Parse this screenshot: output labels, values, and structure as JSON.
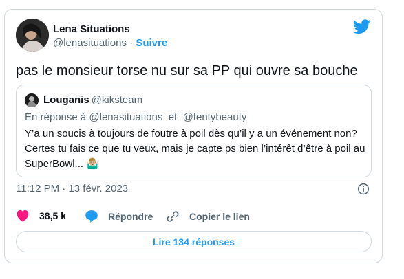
{
  "author": {
    "name": "Lena Situations",
    "handle": "@lenasituations",
    "separator": " · ",
    "follow_label": "Suivre"
  },
  "tweet": {
    "text": "pas le monsieur torse nu sur sa PP qui ouvre sa bouche"
  },
  "quote": {
    "name": "Louganis",
    "handle": "@kiksteam",
    "reply_prefix": "En réponse à",
    "reply_mention_1": "@lenasituations",
    "reply_and": "et",
    "reply_mention_2": "@fentybeauty",
    "body": "Y’a un soucis à toujours de foutre à poil dès qu’il y a un événement non? Certes tu fais ce que tu veux, mais je capte ps bien l’intérêt d’être à poil au SuperBowl... 🤷🏼‍♂️"
  },
  "meta": {
    "timestamp": "11:12 PM · 13 févr. 2023"
  },
  "actions": {
    "like_count": "38,5 k",
    "reply_label": "Répondre",
    "copy_label": "Copier le lien"
  },
  "read_replies_label": "Lire 134 réponses",
  "colors": {
    "brand": "#1d9bf0",
    "like": "#f91880",
    "muted": "#536471",
    "border": "#cfd9de"
  },
  "icons": [
    "twitter-bird-icon",
    "info-icon",
    "heart-icon",
    "reply-bubble-icon",
    "link-icon"
  ]
}
